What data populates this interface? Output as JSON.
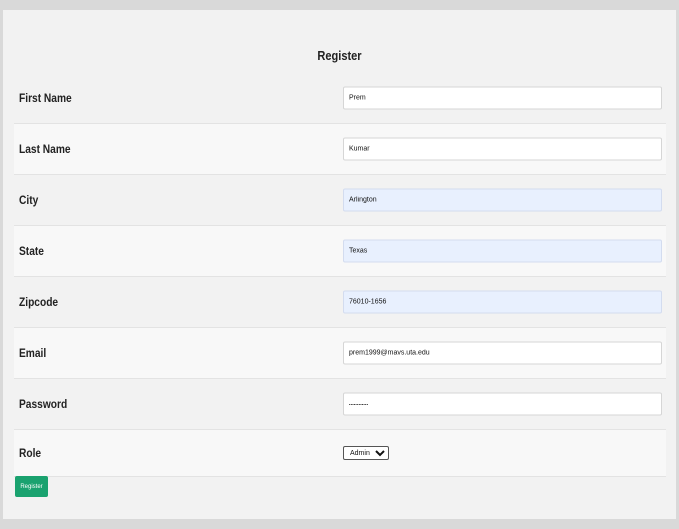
{
  "form": {
    "title": "Register",
    "fields": [
      {
        "label": "First Name",
        "value": "Prem"
      },
      {
        "label": "Last Name",
        "value": "Kumar"
      },
      {
        "label": "City",
        "value": "Arlington"
      },
      {
        "label": "State",
        "value": "Texas"
      },
      {
        "label": "Zipcode",
        "value": "76010-1656"
      },
      {
        "label": "Email",
        "value": "prem1999@mavs.uta.edu"
      },
      {
        "label": "Password",
        "value": "••••••••••••"
      }
    ],
    "role": {
      "label": "Role",
      "selected": "Admin"
    },
    "submit_label": "Register"
  }
}
